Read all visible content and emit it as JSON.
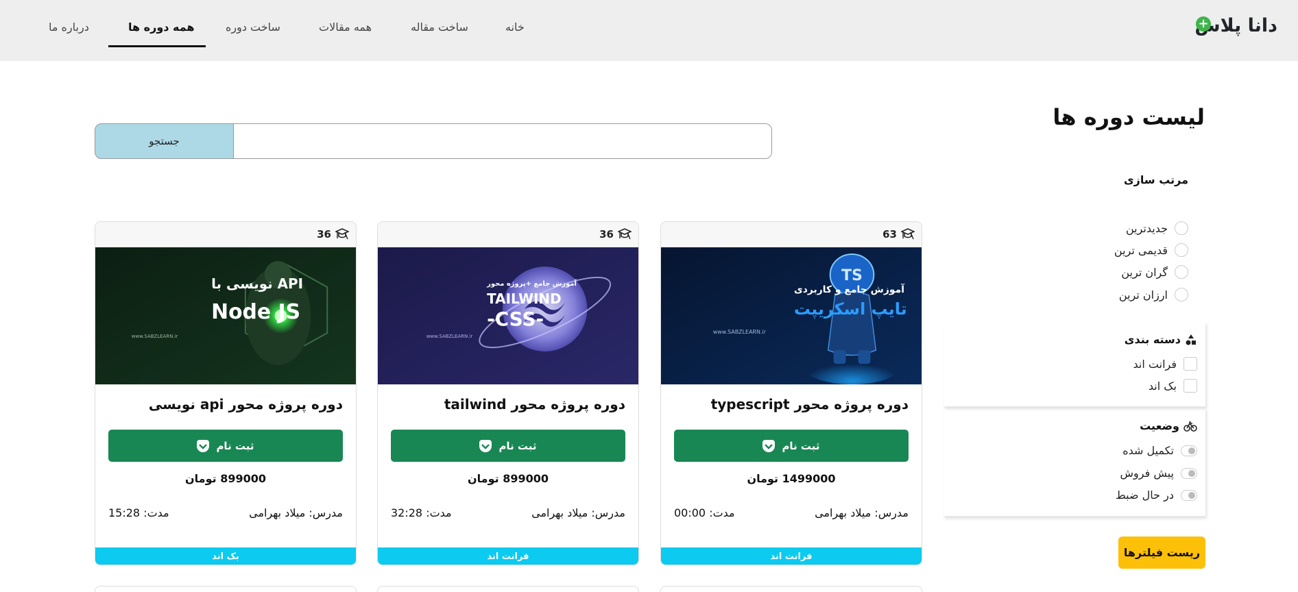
{
  "nav": {
    "brand": "دانا پلاس",
    "links": [
      "خانه",
      "ساخت مقاله",
      "همه مقالات",
      "ساخت دوره",
      "همه دوره ها",
      "درباره ما"
    ]
  },
  "page": {
    "title": "لیست دوره ها"
  },
  "search": {
    "placeholder": "",
    "button": "جستجو"
  },
  "sort": {
    "title": "مرتب سازی",
    "options": [
      "جدیدترین",
      "قدیمی ترین",
      "گران ترین",
      "ارزان ترین"
    ]
  },
  "category": {
    "title": "دسته بندی",
    "options": [
      "فرانت اند",
      "بک اند"
    ]
  },
  "status": {
    "title": "وضعیت",
    "options": [
      "تکمیل شده",
      "پیش فروش",
      "در حال ضبط"
    ]
  },
  "reset_button": "ریست فیلترها",
  "courses": [
    {
      "students": "63",
      "image_lines": [
        "آموزش جامع و کاربردی",
        "تایپ اسکریپت",
        "www.SABZLEARN.ir"
      ],
      "image_badge": "TS",
      "title": "دوره پروژه محور typescript",
      "enroll": "ثبت نام",
      "price": "1499000 تومان",
      "teacher": "مدرس: میلاد بهرامی",
      "duration": "مدت: 00:00",
      "category": "فرانت اند"
    },
    {
      "students": "36",
      "image_lines": [
        "آموزش جامع +پروژه محور",
        "TAILWIND",
        "-CSS-",
        "www.SABZLEARN.ir"
      ],
      "title": "دوره پروژه محور tailwind",
      "enroll": "ثبت نام",
      "price": "899000 تومان",
      "teacher": "مدرس: میلاد بهرامی",
      "duration": "مدت: 32:28",
      "category": "فرانت اند"
    },
    {
      "students": "36",
      "image_lines": [
        "API نویسی با",
        "Node JS",
        "www.SABZLEARN.ir"
      ],
      "title": "دوره پروژه محور api نویسی",
      "enroll": "ثبت نام",
      "price": "899000 تومان",
      "teacher": "مدرس: میلاد بهرامی",
      "duration": "مدت: 15:28",
      "category": "بک اند"
    }
  ],
  "colors": {
    "navbar_bg": "#eeeeee",
    "enroll_green": "#198754",
    "category_cyan": "#0dcaf0",
    "search_blue": "#add8e6",
    "reset_yellow": "#fdc009",
    "brand_plus_green": "#3fb44a"
  },
  "icons": {
    "students": "graduation-cap-icon",
    "enroll": "shield-check-icon",
    "category": "shapes-icon",
    "status": "bicycle-icon",
    "brand": "plus-circle-icon"
  }
}
